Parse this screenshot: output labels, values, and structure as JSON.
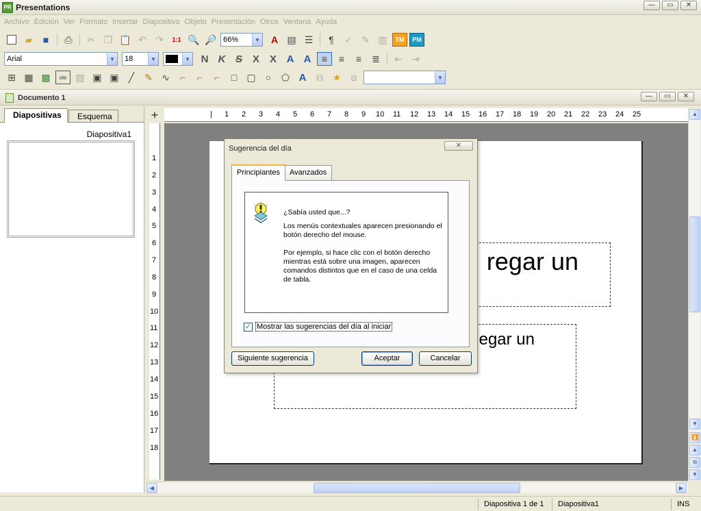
{
  "app": {
    "icon_text": "PR",
    "title": "Presentations",
    "controls": [
      "—",
      "▭",
      "✕"
    ]
  },
  "menu": [
    "Archivo",
    "Edición",
    "Ver",
    "Formato",
    "Insertar",
    "Diapositiva",
    "Objeto",
    "Presentación",
    "Otros",
    "Ventana",
    "Ayuda"
  ],
  "toolbar": {
    "zoom": "66%",
    "font": "Arial",
    "size": "18",
    "tm_label": "TM",
    "pm_label": "PM"
  },
  "document": {
    "title": "Documento 1",
    "controls": [
      "—",
      "▭",
      "✕"
    ]
  },
  "left_pane": {
    "tabs": [
      "Diapositivas",
      "Esquema"
    ],
    "thumb_label": "Diapositiva1"
  },
  "rulers": {
    "h_ticks": [
      "1",
      "1",
      "2",
      "3",
      "4",
      "5",
      "6",
      "7",
      "8",
      "9",
      "10",
      "11",
      "12",
      "13",
      "14",
      "15",
      "16",
      "17",
      "18",
      "19",
      "20",
      "21",
      "22",
      "23",
      "24",
      "25"
    ],
    "v_ticks": [
      "1",
      "2",
      "3",
      "4",
      "5",
      "6",
      "7",
      "8",
      "9",
      "10",
      "11",
      "12",
      "13",
      "14",
      "15",
      "16",
      "17",
      "18"
    ]
  },
  "slide": {
    "title_text": "regar un",
    "subtitle_text": "egar un"
  },
  "dialog": {
    "title": "Sugerencia del día",
    "close": "✕",
    "tabs": [
      "Principiantes",
      "Avanzados"
    ],
    "heading": "¿Sabía usted que...?",
    "para1": "Los menús contextuales aparecen presionando el botón derecho del mouse.",
    "para2": "Por ejemplo, si hace clic con el botón derecho mientras está sobre una imagen, aparecen comandos distintos que en el caso de una celda de tabla.",
    "checkbox_label": "Mostrar las sugerencias del día al iniciar",
    "checkbox_checked": true,
    "btn_next": "Siguiente sugerencia",
    "btn_ok": "Aceptar",
    "btn_cancel": "Cancelar"
  },
  "status": {
    "slide_count": "Diapositiva 1 de 1",
    "slide_name": "Diapositiva1",
    "mode": "INS"
  }
}
